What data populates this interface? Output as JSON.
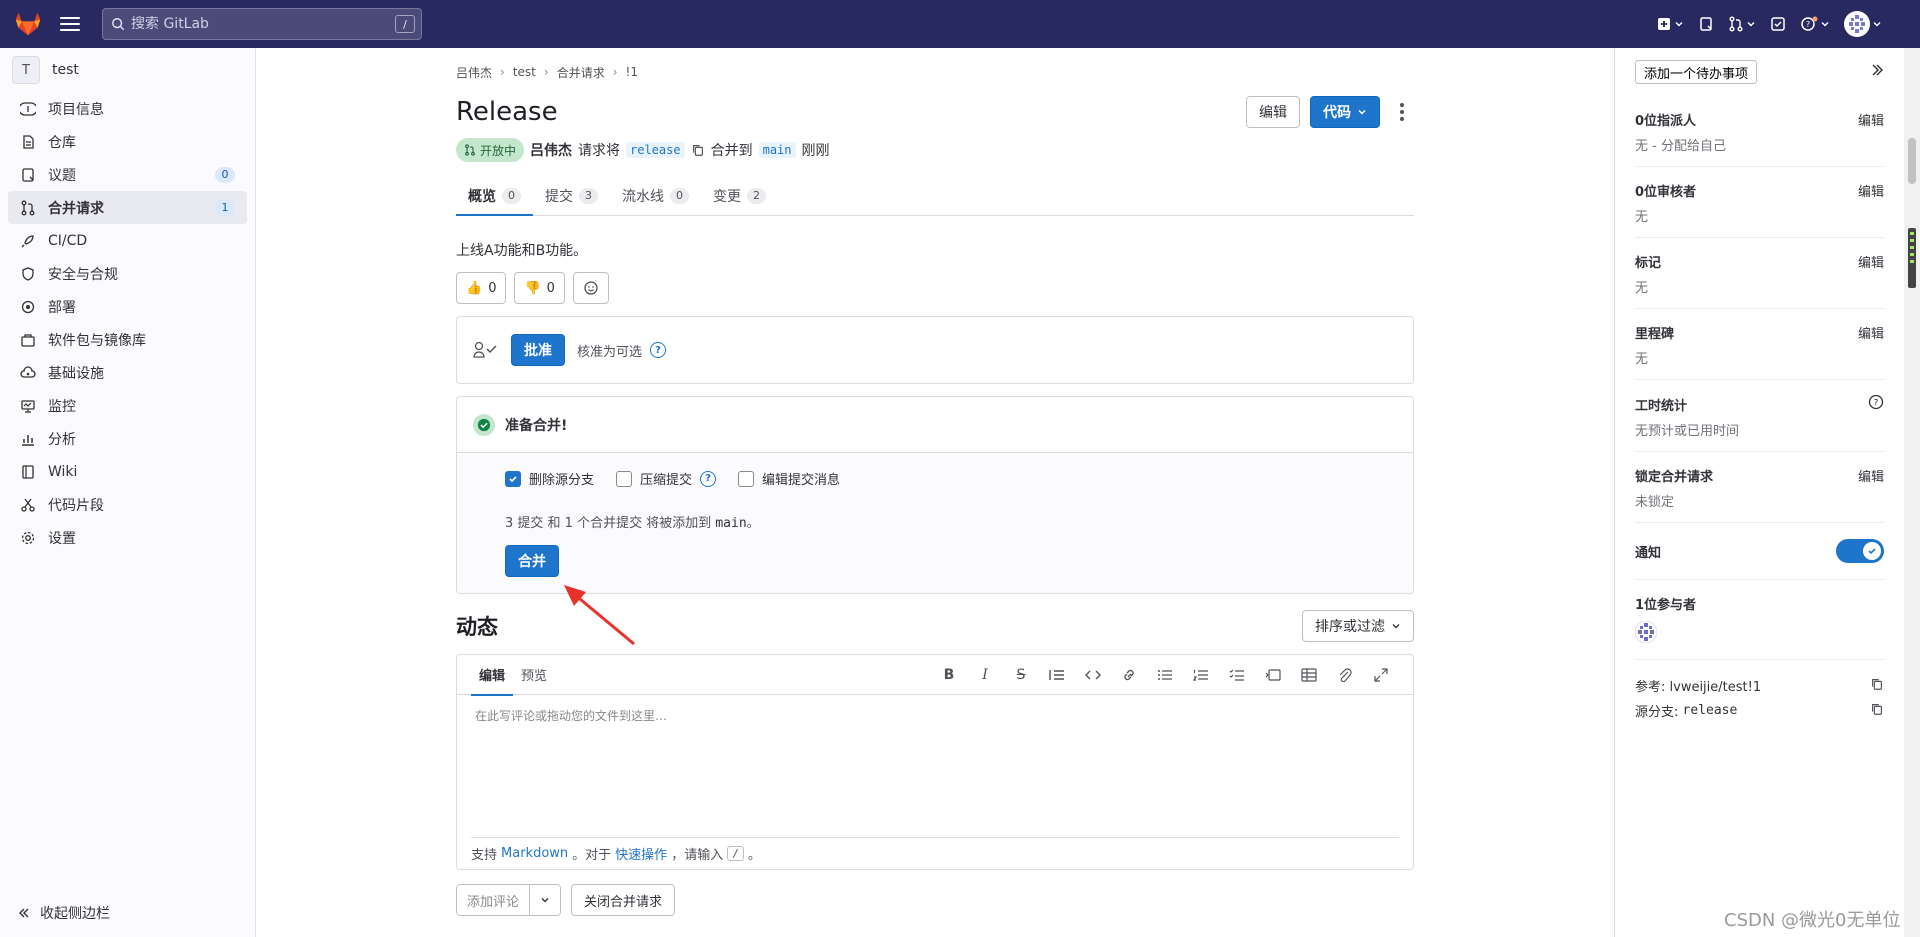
{
  "topbar": {
    "search_placeholder": "搜索 GitLab",
    "search_shortcut": "/"
  },
  "sidebar": {
    "project_initial": "T",
    "project_name": "test",
    "items": [
      {
        "label": "项目信息",
        "icon": "info-icon"
      },
      {
        "label": "仓库",
        "icon": "repository-icon"
      },
      {
        "label": "议题",
        "icon": "issues-icon",
        "count": "0"
      },
      {
        "label": "合并请求",
        "icon": "merge-request-icon",
        "count": "1",
        "active": true
      },
      {
        "label": "CI/CD",
        "icon": "rocket-icon"
      },
      {
        "label": "安全与合规",
        "icon": "shield-icon"
      },
      {
        "label": "部署",
        "icon": "deployments-icon"
      },
      {
        "label": "软件包与镜像库",
        "icon": "package-icon"
      },
      {
        "label": "基础设施",
        "icon": "cloud-gear-icon"
      },
      {
        "label": "监控",
        "icon": "monitor-icon"
      },
      {
        "label": "分析",
        "icon": "chart-icon"
      },
      {
        "label": "Wiki",
        "icon": "book-icon"
      },
      {
        "label": "代码片段",
        "icon": "snippet-icon"
      },
      {
        "label": "设置",
        "icon": "settings-icon"
      }
    ],
    "collapse_label": "收起侧边栏"
  },
  "breadcrumb": [
    "吕伟杰",
    "test",
    "合并请求",
    "!1"
  ],
  "mr": {
    "title": "Release",
    "edit_label": "编辑",
    "code_label": "代码",
    "status": "开放中",
    "author": "吕伟杰",
    "request_text": "请求将",
    "source_branch": "release",
    "merge_into_text": "合并到",
    "target_branch": "main",
    "time": "刚刚"
  },
  "tabs": [
    {
      "label": "概览",
      "count": "0",
      "active": true
    },
    {
      "label": "提交",
      "count": "3"
    },
    {
      "label": "流水线",
      "count": "0"
    },
    {
      "label": "变更",
      "count": "2"
    }
  ],
  "description": "上线A功能和B功能。",
  "reactions": {
    "thumbs_up": "0",
    "thumbs_down": "0"
  },
  "approval": {
    "button": "批准",
    "optional_text": "核准为可选"
  },
  "merge_widget": {
    "status": "准备合并!",
    "opt_delete_source": "删除源分支",
    "opt_squash": "压缩提交",
    "opt_edit_message": "编辑提交消息",
    "info_prefix": "3 提交 和 1 个合并提交 将被添加到",
    "info_branch": "main",
    "info_suffix": "。",
    "merge_button": "合并"
  },
  "activity": {
    "title": "动态",
    "sort_label": "排序或过滤"
  },
  "editor": {
    "tab_write": "编辑",
    "tab_preview": "预览",
    "placeholder": "在此写评论或拖动您的文件到这里…",
    "footer_support": "支持",
    "footer_markdown": "Markdown",
    "footer_for": "。对于",
    "footer_quick": "快速操作",
    "footer_type": "，请输入",
    "footer_key": "/",
    "footer_end": "。"
  },
  "actions": {
    "add_comment": "添加评论",
    "close_mr": "关闭合并请求"
  },
  "right_sidebar": {
    "todo": "添加一个待办事项",
    "assignee_label": "0位指派人",
    "assignee_value": "无 - 分配给自己",
    "reviewer_label": "0位审核者",
    "reviewer_value": "无",
    "labels_label": "标记",
    "labels_value": "无",
    "milestone_label": "里程碑",
    "milestone_value": "无",
    "time_label": "工时统计",
    "time_value": "无预计或已用时间",
    "lock_label": "锁定合并请求",
    "lock_value": "未锁定",
    "notify_label": "通知",
    "participants_label": "1位参与者",
    "edit": "编辑",
    "ref_label": "参考: lvweijie/test!1",
    "source_label": "源分支:",
    "source_value": "release"
  },
  "watermark": "CSDN @微光0无单位",
  "colors": {
    "brand_nav": "#292961",
    "primary": "#1f75cb",
    "success_bg": "#c3e6cd",
    "annotation": "#e8322b"
  }
}
